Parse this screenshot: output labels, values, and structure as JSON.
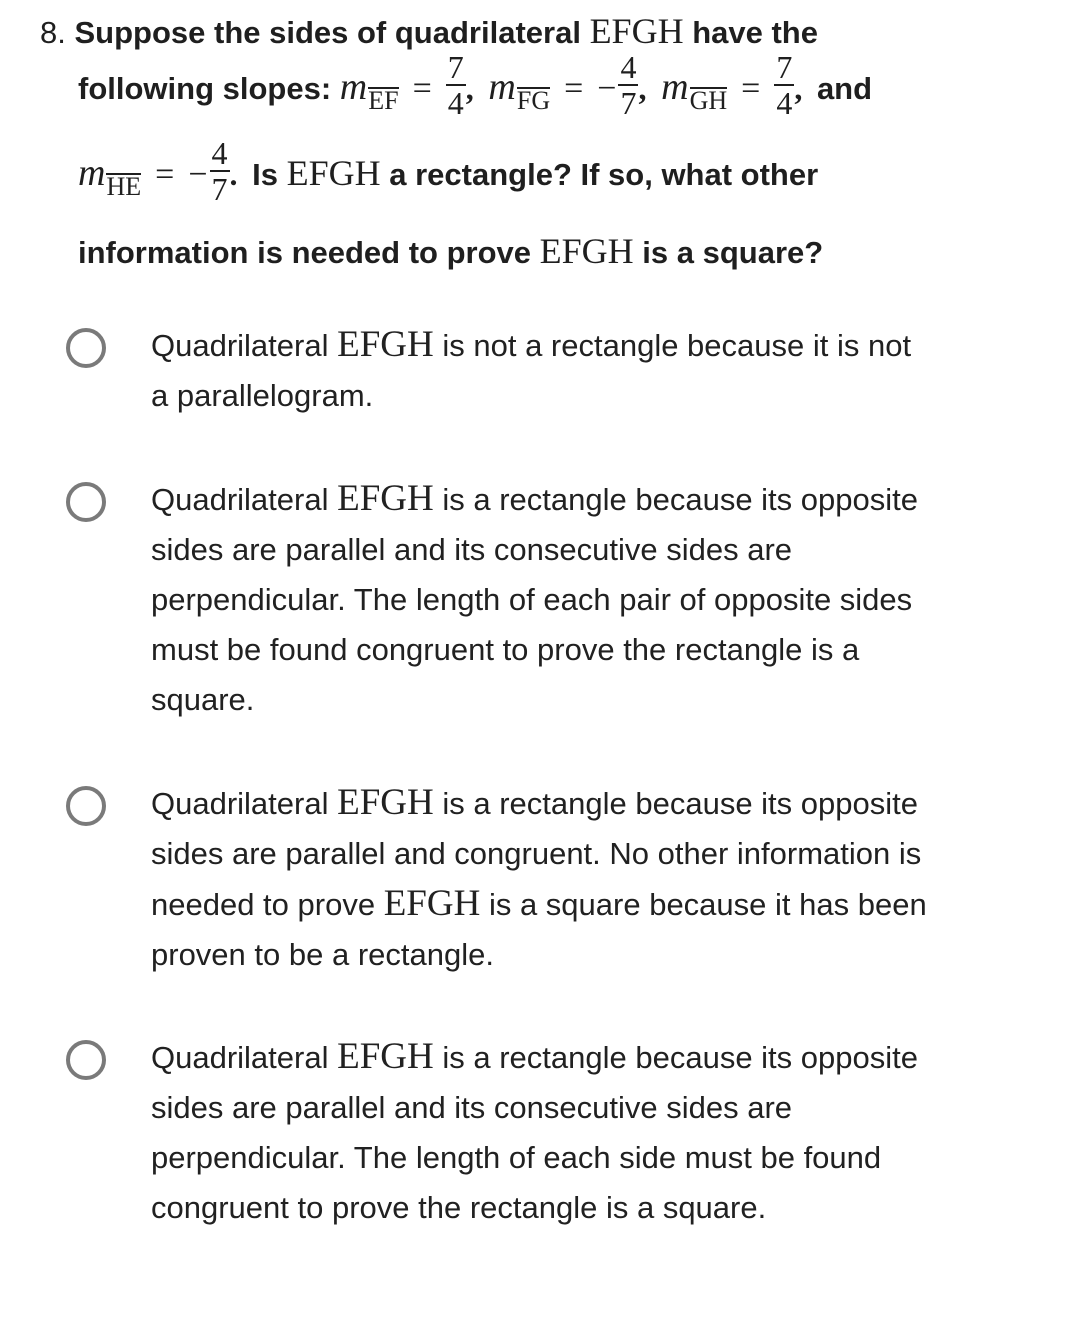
{
  "question": {
    "number": "8.",
    "line1_text": "Suppose the sides of quadrilateral",
    "shape_name": "EFGH",
    "line1_tail": "have the",
    "line2_lead": "following slopes:",
    "slope_symbol": "m",
    "slopes": [
      {
        "segment": "EF",
        "sign": "",
        "numerator": "7",
        "denominator": "4",
        "separator": ","
      },
      {
        "segment": "FG",
        "sign": "−",
        "numerator": "4",
        "denominator": "7",
        "separator": ","
      },
      {
        "segment": "GH",
        "sign": "",
        "numerator": "7",
        "denominator": "4",
        "separator": ","
      },
      {
        "segment": "HE",
        "sign": "−",
        "numerator": "4",
        "denominator": "7",
        "separator": "."
      }
    ],
    "equals": "=",
    "and_word": "and",
    "line3_a": "Is",
    "line3_b": "a rectangle? If so, what other",
    "line4_a": "information is needed to prove",
    "line4_b": "is a square?"
  },
  "options": [
    {
      "selected": false,
      "prefix": "Quadrilateral",
      "shape": "EFGH",
      "line1_rest": "is not a rectangle because it is not",
      "lines": [
        "a parallelogram."
      ]
    },
    {
      "selected": false,
      "prefix": "Quadrilateral",
      "shape": "EFGH",
      "line1_rest": "is a rectangle because its opposite",
      "lines": [
        "sides are parallel and its consecutive sides are",
        "perpendicular. The length of each pair of opposite sides",
        "must be found congruent to prove the rectangle is a",
        "square."
      ]
    },
    {
      "selected": false,
      "prefix": "Quadrilateral",
      "shape": "EFGH",
      "line1_rest": "is a rectangle because its opposite",
      "lines": [
        "sides are parallel and congruent. No other information is"
      ],
      "line3_prefix": "needed to prove",
      "line3_shape": "EFGH",
      "line3_rest": "is a square because it has been",
      "line4": "proven to be a rectangle."
    },
    {
      "selected": false,
      "prefix": "Quadrilateral",
      "shape": "EFGH",
      "line1_rest": "is a rectangle because its opposite",
      "lines": [
        "sides are parallel and its consecutive sides are",
        "perpendicular. The length of each side must be found",
        "congruent to prove the rectangle is a square."
      ]
    }
  ],
  "colors": {
    "text": "#212121",
    "radio_border": "#7a7a7a",
    "background": "#ffffff"
  }
}
